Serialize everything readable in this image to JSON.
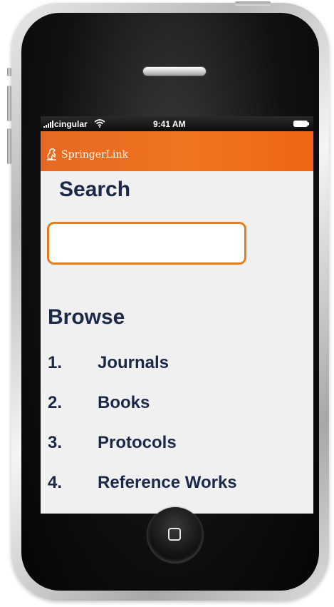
{
  "status_bar": {
    "carrier": "cingular",
    "time": "9:41 AM",
    "icons": [
      "signal-icon",
      "wifi-icon",
      "battery-icon"
    ]
  },
  "brand": {
    "name": "SpringerLink",
    "logo_icon": "springer-horse-icon",
    "color": "#ef6d1f"
  },
  "search": {
    "title": "Search",
    "value": "",
    "placeholder": "",
    "border_color": "#e47e1d"
  },
  "browse": {
    "title": "Browse",
    "items": [
      {
        "number": "1.",
        "label": "Journals"
      },
      {
        "number": "2.",
        "label": "Books"
      },
      {
        "number": "3.",
        "label": "Protocols"
      },
      {
        "number": "4.",
        "label": "Reference Works"
      }
    ]
  },
  "colors": {
    "heading": "#1c2848",
    "screen_bg": "#f0f0f0"
  },
  "device": {
    "home_icon": "home-square-icon"
  }
}
